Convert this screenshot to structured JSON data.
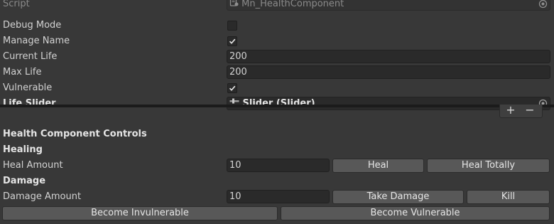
{
  "inspector": {
    "script_label": "Script",
    "script_value": "Mn_HealthComponent",
    "debug_mode_label": "Debug Mode",
    "debug_mode_checked": false,
    "manage_name_label": "Manage Name",
    "manage_name_checked": true,
    "current_life_label": "Current Life",
    "current_life_value": "200",
    "max_life_label": "Max Life",
    "max_life_value": "200",
    "vulnerable_label": "Vulnerable",
    "vulnerable_checked": true,
    "life_slider_label": "Life Slider",
    "life_slider_value": "Slider (Slider)"
  },
  "list_controls": {
    "plus": "+",
    "minus": "−"
  },
  "controls": {
    "title": "Health Component Controls",
    "healing_header": "Healing",
    "heal_amount_label": "Heal Amount",
    "heal_amount_value": "10",
    "heal_button": "Heal",
    "heal_totally_button": "Heal Totally",
    "damage_header": "Damage",
    "damage_amount_label": "Damage Amount",
    "damage_amount_value": "10",
    "take_damage_button": "Take Damage",
    "kill_button": "Kill",
    "become_invulnerable_button": "Become Invulnerable",
    "become_vulnerable_button": "Become Vulnerable"
  },
  "icons": {
    "script": "script-icon",
    "object_picker": "object-picker-icon",
    "slider": "slider-icon",
    "checkmark": "checkmark-icon"
  }
}
